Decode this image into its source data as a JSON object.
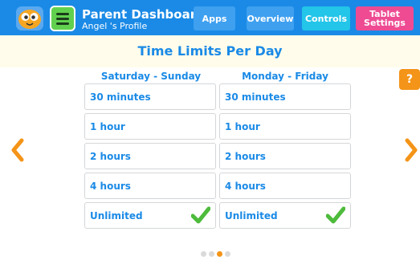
{
  "header": {
    "title": "Parent Dashboard",
    "subtitle": "Angel 's Profile",
    "tabs": [
      {
        "label": "Apps"
      },
      {
        "label": "Overview"
      },
      {
        "label": "Controls"
      },
      {
        "label": "Tablet Settings"
      }
    ]
  },
  "page": {
    "title": "Time Limits Per Day",
    "help": "?"
  },
  "columns": [
    {
      "heading": "Saturday - Sunday",
      "options": [
        {
          "label": "30 minutes",
          "selected": false
        },
        {
          "label": "1 hour",
          "selected": false
        },
        {
          "label": "2 hours",
          "selected": false
        },
        {
          "label": "4 hours",
          "selected": false
        },
        {
          "label": "Unlimited",
          "selected": true
        }
      ]
    },
    {
      "heading": "Monday - Friday",
      "options": [
        {
          "label": "30 minutes",
          "selected": false
        },
        {
          "label": "1 hour",
          "selected": false
        },
        {
          "label": "2 hours",
          "selected": false
        },
        {
          "label": "4 hours",
          "selected": false
        },
        {
          "label": "Unlimited",
          "selected": true
        }
      ]
    }
  ],
  "pagination": {
    "count": 4,
    "active": 3
  },
  "icons": {
    "logo": "owl-logo-icon",
    "menu": "menu-icon",
    "prev": "chevron-left-icon",
    "next": "chevron-right-icon",
    "check": "checkmark-icon"
  },
  "colors": {
    "primary": "#1a8ae6",
    "accent_orange": "#f49418",
    "accent_pink": "#ee4b93",
    "check_green": "#4dbb3b"
  }
}
